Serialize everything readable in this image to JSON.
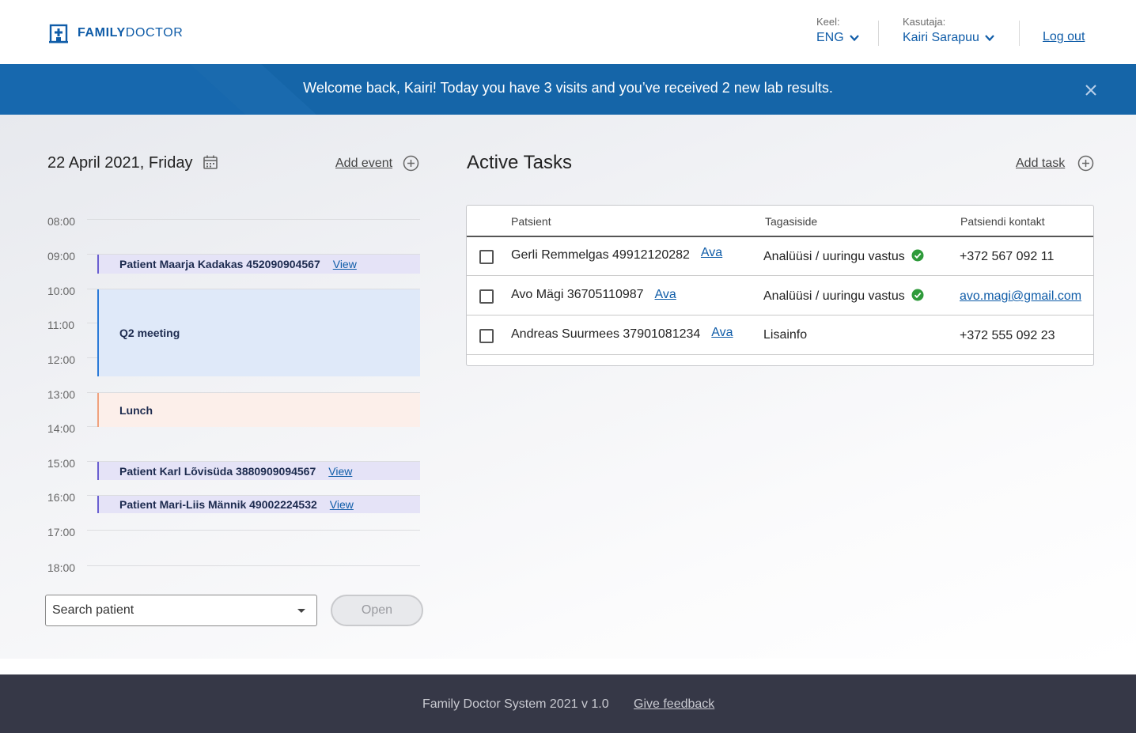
{
  "header": {
    "logo_bold": "FAMILY",
    "logo_light": "DOCTOR",
    "language_label": "Keel:",
    "language_value": "ENG",
    "user_label": "Kasutaja:",
    "user_value": "Kairi Sarapuu",
    "logout_label": "Log out"
  },
  "banner": {
    "message": "Welcome back, Kairi! Today you have 3 visits and you’ve received 2 new lab results."
  },
  "calendar": {
    "date_title": "22 April 2021, Friday",
    "add_event_label": "Add event",
    "hours": [
      "08:00",
      "09:00",
      "10:00",
      "11:00",
      "12:00",
      "13:00",
      "14:00",
      "15:00",
      "16:00",
      "17:00",
      "18:00"
    ],
    "events": [
      {
        "title": "Patient Maarja Kadakas 452090904567",
        "link": "View"
      },
      {
        "title": "Q2 meeting"
      },
      {
        "title": "Lunch"
      },
      {
        "title": "Patient Karl Lõvisüda 3880909094567",
        "link": "View"
      },
      {
        "title": "Patient Mari-Liis Männik 49002224532",
        "link": "View"
      }
    ],
    "search_placeholder": "Search patient",
    "open_label": "Open"
  },
  "tasks": {
    "title": "Active Tasks",
    "add_task_label": "Add task",
    "columns": [
      "Patsient",
      "Tagasiside",
      "Patsiendi kontakt"
    ],
    "rows": [
      {
        "patient": "Gerli Remmelgas 49912120282",
        "link": "Ava",
        "feedback": "Analüüsi / uuringu vastus",
        "feedback_done": true,
        "contact": "+372 567 092 11",
        "contact_is_link": false
      },
      {
        "patient": "Avo Mägi 36705110987",
        "link": "Ava",
        "feedback": "Analüüsi / uuringu vastus",
        "feedback_done": true,
        "contact": "avo.magi@gmail.com",
        "contact_is_link": true
      },
      {
        "patient": "Andreas Suurmees 37901081234",
        "link": "Ava",
        "feedback": "Lisainfo",
        "feedback_done": false,
        "contact": "+372 555 092 23",
        "contact_is_link": false
      }
    ]
  },
  "footer": {
    "system_text": "Family Doctor System 2021 v 1.0",
    "feedback_label": "Give feedback"
  },
  "colors": {
    "brand_blue": "#0f5ca8",
    "banner_blue": "#1565a8",
    "footer_bg": "#363847",
    "patient_event": "#e5e3f7",
    "meeting_event": "#dfe9f9",
    "lunch_event": "#fcefea",
    "status_green": "#2e9a3a"
  },
  "icons": {
    "logo": "hospital-icon",
    "calendar": "calendar-icon",
    "add": "plus-circle-icon",
    "close": "close-icon",
    "dropdown": "chevron-down-icon",
    "status": "check-circle-icon"
  }
}
